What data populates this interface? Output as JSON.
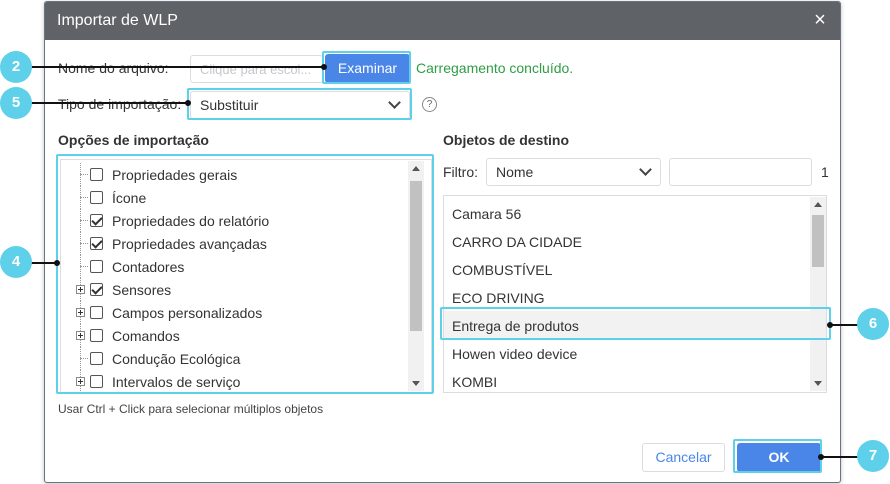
{
  "dialog": {
    "title": "Importar de WLP",
    "close_glyph": "×"
  },
  "file": {
    "label": "Nome do arquivo:",
    "placeholder": "Clique para escol...",
    "browse_label": "Examinar",
    "status": "Carregamento concluído."
  },
  "import_type": {
    "label": "Tipo de importação:",
    "value": "Substituir",
    "help_glyph": "?"
  },
  "options": {
    "heading": "Opções de importação",
    "items": [
      {
        "label": "Propriedades gerais",
        "checked": false,
        "expandable": false
      },
      {
        "label": "Ícone",
        "checked": false,
        "expandable": false
      },
      {
        "label": "Propriedades do relatório",
        "checked": true,
        "expandable": false
      },
      {
        "label": "Propriedades avançadas",
        "checked": true,
        "expandable": false
      },
      {
        "label": "Contadores",
        "checked": false,
        "expandable": false
      },
      {
        "label": "Sensores",
        "checked": true,
        "expandable": true
      },
      {
        "label": "Campos personalizados",
        "checked": false,
        "expandable": true
      },
      {
        "label": "Comandos",
        "checked": false,
        "expandable": true
      },
      {
        "label": "Condução Ecológica",
        "checked": false,
        "expandable": false
      },
      {
        "label": "Intervalos de serviço",
        "checked": false,
        "expandable": true
      }
    ],
    "hint": "Usar Ctrl + Click para selecionar múltiplos objetos"
  },
  "targets": {
    "heading": "Objetos de destino",
    "filter_label": "Filtro:",
    "filter_value": "Nome",
    "filter_text": "",
    "count": "1",
    "items": [
      {
        "label": "Camara 56",
        "selected": false
      },
      {
        "label": "CARRO DA CIDADE",
        "selected": false
      },
      {
        "label": "COMBUSTÍVEL",
        "selected": false
      },
      {
        "label": "ECO DRIVING",
        "selected": false
      },
      {
        "label": "Entrega de produtos",
        "selected": true
      },
      {
        "label": "Howen video device",
        "selected": false
      },
      {
        "label": "KOMBI",
        "selected": false
      }
    ]
  },
  "footer": {
    "cancel_label": "Cancelar",
    "ok_label": "OK"
  },
  "callouts": {
    "c2": "2",
    "c4": "4",
    "c5": "5",
    "c6": "6",
    "c7": "7"
  },
  "colors": {
    "accent": "#4a86e8",
    "highlight": "#5ed0ea",
    "success": "#2e9e44",
    "titlebar": "#5f6368"
  }
}
